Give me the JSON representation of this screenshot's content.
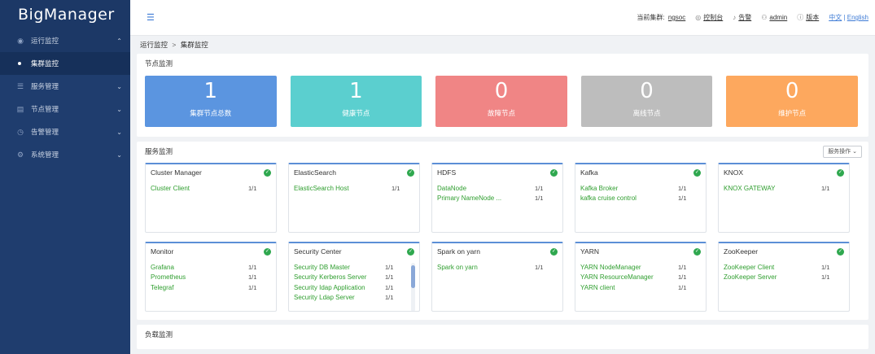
{
  "app": {
    "logo": "BigManager"
  },
  "sidebar": {
    "items": [
      {
        "icon": "eye-icon",
        "label": "运行监控",
        "chevron": "⌃"
      },
      {
        "icon": "list-icon",
        "label": "服务管理",
        "chevron": "⌄"
      },
      {
        "icon": "server-icon",
        "label": "节点管理",
        "chevron": "⌄"
      },
      {
        "icon": "alarm-icon",
        "label": "告警管理",
        "chevron": "⌄"
      },
      {
        "icon": "gear-icon",
        "label": "系统管理",
        "chevron": "⌄"
      }
    ],
    "sub_item": "集群监控"
  },
  "header": {
    "cluster_label": "当前集群:",
    "cluster_value": "ngsoc",
    "console": "控制台",
    "alarm": "告警",
    "user": "admin",
    "version": "版本",
    "lang_zh": "中文",
    "lang_sep": "|",
    "lang_en": "English"
  },
  "breadcrumb": {
    "parent": "运行监控",
    "sep": ">",
    "current": "集群监控"
  },
  "node_panel": {
    "title": "节点监测",
    "cards": [
      {
        "value": "1",
        "label": "集群节点总数",
        "color": "#5b95e0"
      },
      {
        "value": "1",
        "label": "健康节点",
        "color": "#5bcfcf"
      },
      {
        "value": "0",
        "label": "故障节点",
        "color": "#f08585"
      },
      {
        "value": "0",
        "label": "离线节点",
        "color": "#bdbdbd"
      },
      {
        "value": "0",
        "label": "维护节点",
        "color": "#fda85e"
      }
    ]
  },
  "service_panel": {
    "title": "服务监测",
    "ops_button": "服务操作 ⌄",
    "cards": [
      {
        "title": "Cluster Manager",
        "rows": [
          {
            "name": "Cluster Client",
            "count": "1/1"
          }
        ]
      },
      {
        "title": "ElasticSearch",
        "rows": [
          {
            "name": "ElasticSearch Host",
            "count": "1/1"
          }
        ]
      },
      {
        "title": "HDFS",
        "rows": [
          {
            "name": "DataNode",
            "count": "1/1"
          },
          {
            "name": "Primary NameNode ...",
            "count": "1/1"
          }
        ]
      },
      {
        "title": "Kafka",
        "rows": [
          {
            "name": "Kafka Broker",
            "count": "1/1"
          },
          {
            "name": "kafka cruise control",
            "count": "1/1"
          }
        ]
      },
      {
        "title": "KNOX",
        "rows": [
          {
            "name": "KNOX GATEWAY",
            "count": "1/1"
          }
        ]
      },
      {
        "title": "Monitor",
        "rows": [
          {
            "name": "Grafana",
            "count": "1/1"
          },
          {
            "name": "Prometheus",
            "count": "1/1"
          },
          {
            "name": "Telegraf",
            "count": "1/1"
          }
        ]
      },
      {
        "title": "Security Center",
        "rows": [
          {
            "name": "Security DB Master",
            "count": "1/1"
          },
          {
            "name": "Security Kerberos Server",
            "count": "1/1"
          },
          {
            "name": "Security Idap Application",
            "count": "1/1"
          },
          {
            "name": "Security Ldap Server",
            "count": "1/1"
          }
        ]
      },
      {
        "title": "Spark on yarn",
        "rows": [
          {
            "name": "Spark on yarn",
            "count": "1/1"
          }
        ]
      },
      {
        "title": "YARN",
        "rows": [
          {
            "name": "YARN NodeManager",
            "count": "1/1"
          },
          {
            "name": "YARN ResourceManager",
            "count": "1/1"
          },
          {
            "name": "YARN client",
            "count": "1/1"
          }
        ]
      },
      {
        "title": "ZooKeeper",
        "rows": [
          {
            "name": "ZooKeeper Client",
            "count": "1/1"
          },
          {
            "name": "ZooKeeper Server",
            "count": "1/1"
          }
        ]
      }
    ]
  },
  "bottom_panel": {
    "title": "负载监测"
  }
}
